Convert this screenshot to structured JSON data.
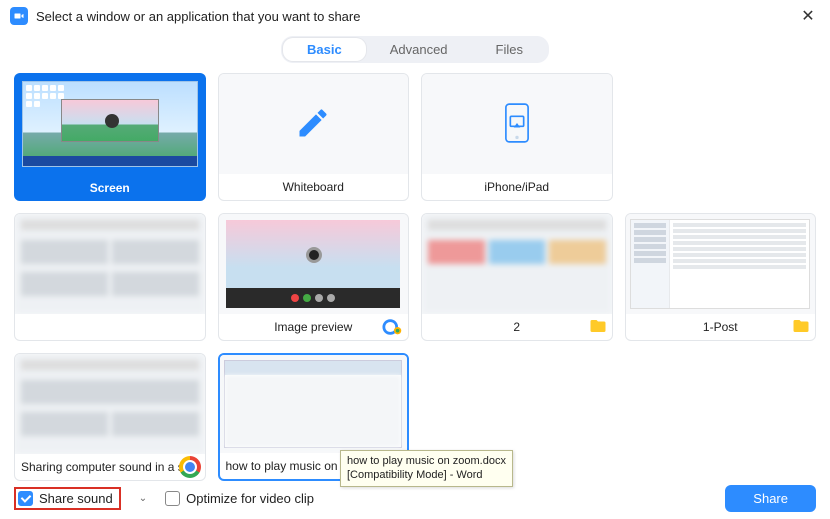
{
  "header": {
    "title": "Select a window or an application that you want to share"
  },
  "tabs": {
    "basic": "Basic",
    "advanced": "Advanced",
    "files": "Files"
  },
  "tiles": {
    "screen": "Screen",
    "whiteboard": "Whiteboard",
    "iphone": "iPhone/iPad",
    "app1": "",
    "imagePreview": "Image preview",
    "app2": "2",
    "onePost": "1-Post",
    "chromeApp": "Sharing computer sound in a scr...",
    "wordApp": "how to play music on zoom"
  },
  "tooltip": {
    "line1": "how to play music on zoom.docx",
    "line2": "[Compatibility Mode] - Word"
  },
  "footer": {
    "shareSound": "Share sound",
    "optimize": "Optimize for video clip",
    "shareBtn": "Share"
  }
}
